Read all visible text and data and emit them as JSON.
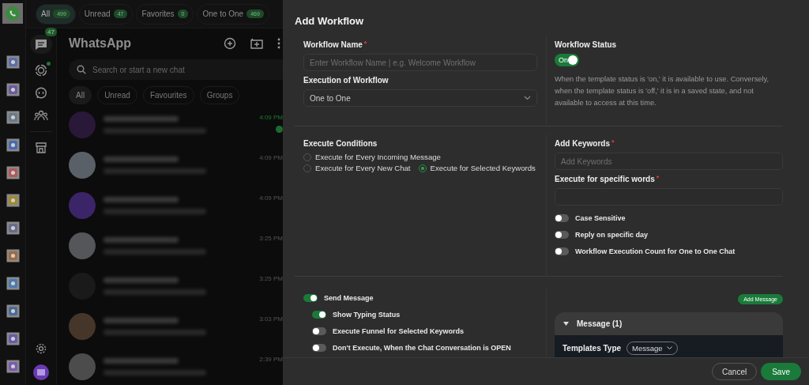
{
  "filter_tabs": [
    {
      "label": "All",
      "count": "499",
      "selected": true
    },
    {
      "label": "Unread",
      "count": "47",
      "selected": false
    },
    {
      "label": "Favorites",
      "count": "0",
      "selected": false
    },
    {
      "label": "One to One",
      "count": "469",
      "selected": false
    }
  ],
  "nav": {
    "chats_badge": "47"
  },
  "chat_header": {
    "title": "WhatsApp"
  },
  "search": {
    "placeholder": "Search or start a new chat"
  },
  "chat_filters": [
    {
      "label": "All",
      "selected": true
    },
    {
      "label": "Unread",
      "selected": false
    },
    {
      "label": "Favourites",
      "selected": false
    },
    {
      "label": "Groups",
      "selected": false
    }
  ],
  "chats": [
    {
      "time": "4:09 PM",
      "unread": true,
      "color": "#2a1838"
    },
    {
      "time": "4:09 PM",
      "unread": false,
      "color": "#5a6068"
    },
    {
      "time": "4:09 PM",
      "unread": false,
      "color": "#3c2468"
    },
    {
      "time": "3:25 PM",
      "unread": false,
      "color": "#54565a"
    },
    {
      "time": "3:25 PM",
      "unread": false,
      "color": "#1a1a1a"
    },
    {
      "time": "3:03 PM",
      "unread": false,
      "color": "#46362a"
    },
    {
      "time": "2:39 PM",
      "unread": false,
      "color": "#4c4c4c"
    }
  ],
  "modal": {
    "title": "Add Workflow",
    "workflow_name": {
      "label": "Workflow Name",
      "required_mark": "*",
      "placeholder": "Enter Workflow Name | e.g. Welcome Workflow"
    },
    "execution": {
      "label": "Execution of Workflow",
      "value": "One to One"
    },
    "status": {
      "label": "Workflow Status",
      "toggle_label": "On",
      "on": true,
      "description": "When the template status is 'on,' it is available to use. Conversely, when the template status is 'off,' it is in a saved state, and not available to access at this time."
    },
    "conditions": {
      "label": "Execute Conditions",
      "options": [
        {
          "label": "Execute for Every Incoming Message",
          "selected": false
        },
        {
          "label": "Execute for Every New Chat",
          "selected": false
        },
        {
          "label": "Execute for Selected Keywords",
          "selected": true
        }
      ]
    },
    "keywords": {
      "label": "Add Keywords",
      "required_mark": "*",
      "placeholder": "Add Keywords"
    },
    "specific_words": {
      "label": "Execute for specific words",
      "required_mark": "*"
    },
    "switches": [
      {
        "label": "Case Sensitive",
        "on": false
      },
      {
        "label": "Reply on specific day",
        "on": false
      },
      {
        "label": "Workflow Execution Count for One to One Chat",
        "on": false
      }
    ],
    "send_options": [
      {
        "label": "Send Message",
        "on": true,
        "children": [
          {
            "label": "Show Typing Status",
            "on": true
          },
          {
            "label": "Execute Funnel for Selected Keywords",
            "on": false
          },
          {
            "label": "Don't Execute, When the Chat Conversation is OPEN",
            "on": false
          }
        ]
      }
    ],
    "add_message_button": "Add Message",
    "message_panel": {
      "title": "Message (1)",
      "expanded": true,
      "templates_type_label": "Templates Type",
      "templates_type_value": "Message"
    },
    "buttons": {
      "cancel": "Cancel",
      "save": "Save"
    }
  }
}
